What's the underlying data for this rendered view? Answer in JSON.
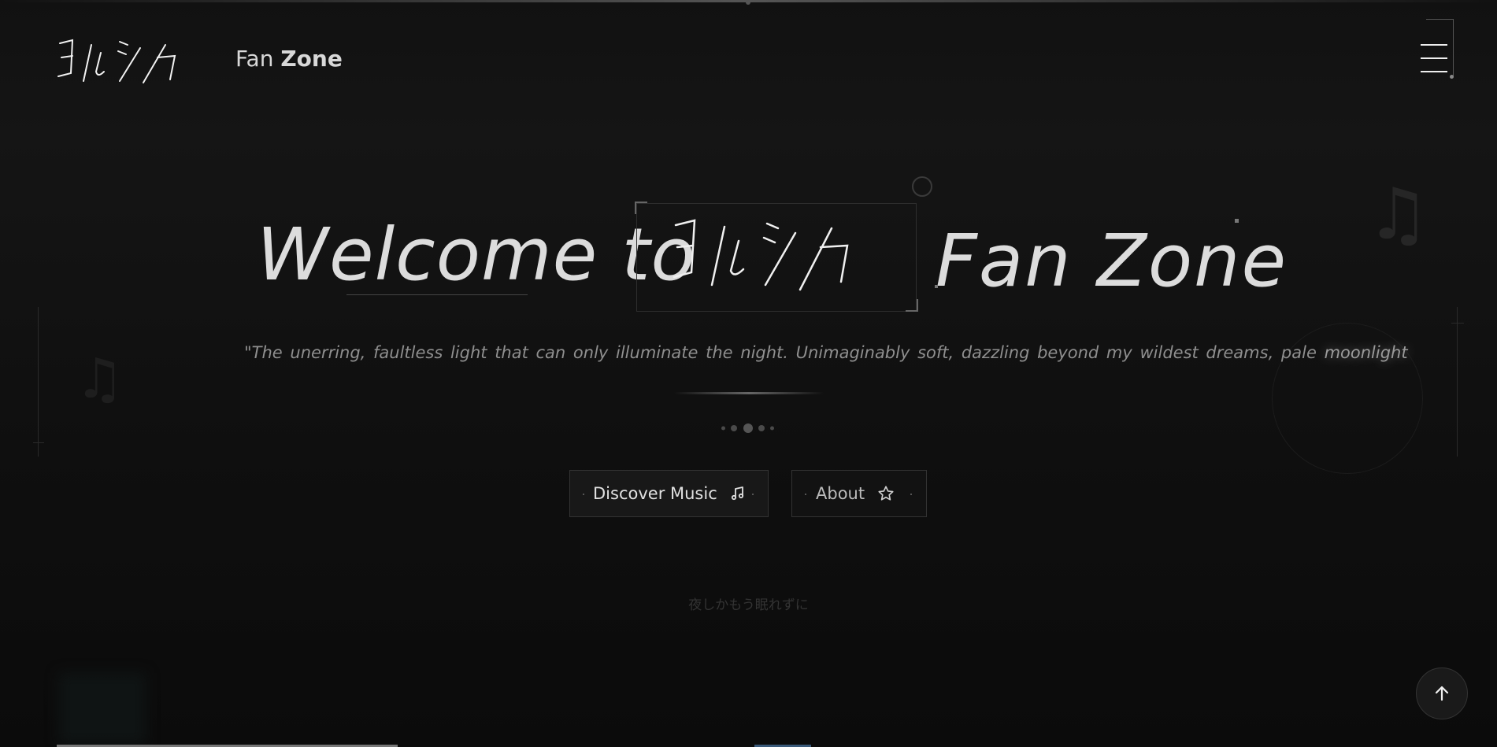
{
  "header": {
    "logo_name": "yorushika-logo",
    "brand_prefix": "Fan",
    "brand_bold": "Zone",
    "menu_icon": "hamburger-icon"
  },
  "hero": {
    "title_welcome": "Welcome to",
    "title_fanzone": "Fan Zone",
    "title_logo": "yorushika-logo",
    "quote_main": "\"The unerring, faultless light that can only illuminate the night. Unimaginably soft, dazzling beyond my wildest dreams, pale",
    "quote_highlight": "moonlight"
  },
  "buttons": {
    "discover_label": "Discover Music",
    "discover_icon": "music-note-icon",
    "about_label": "About",
    "about_icon": "star-icon"
  },
  "japanese_line": "夜しかもう眠れずに",
  "scroll_top_icon": "arrow-up-icon",
  "colors": {
    "background": "#111111",
    "text": "#dcdcdc",
    "muted": "#8f8f8f",
    "accent_bar": "#3a5a7a"
  }
}
